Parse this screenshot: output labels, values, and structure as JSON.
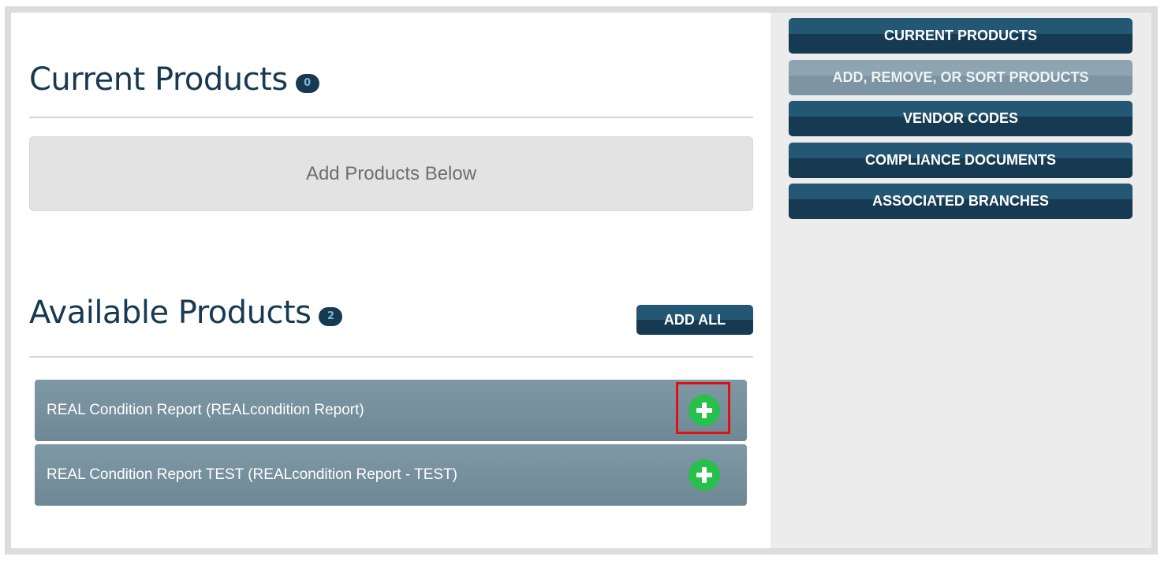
{
  "current_section": {
    "title": "Current Products",
    "count": "0",
    "empty_text": "Add Products Below"
  },
  "available_section": {
    "title": "Available Products",
    "count": "2",
    "add_all_label": "ADD ALL",
    "products": [
      {
        "label": "REAL Condition Report (REALcondition Report)",
        "highlighted": true
      },
      {
        "label": "REAL Condition Report TEST (REALcondition Report - TEST)",
        "highlighted": false
      }
    ]
  },
  "sidebar": {
    "items": [
      {
        "label": "CURRENT PRODUCTS",
        "active": false
      },
      {
        "label": "ADD, REMOVE, OR SORT PRODUCTS",
        "active": true
      },
      {
        "label": "VENDOR CODES",
        "active": false
      },
      {
        "label": "COMPLIANCE DOCUMENTS",
        "active": false
      },
      {
        "label": "ASSOCIATED BRANCHES",
        "active": false
      }
    ]
  },
  "colors": {
    "title_text": "#173a52",
    "button_dark": "#163a52",
    "button_active": "#7d95a2",
    "add_green": "#27c04a",
    "highlight_red": "#e01010"
  },
  "icons": {
    "add_product": "plus-icon"
  }
}
